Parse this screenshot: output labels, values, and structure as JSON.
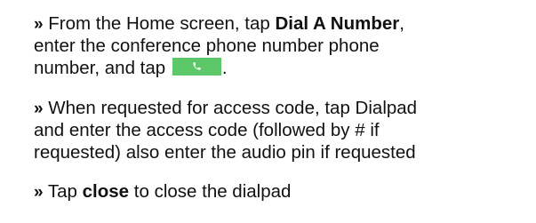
{
  "step1": {
    "bullet": "»",
    "line1_pre": "From the Home screen, tap ",
    "line1_bold": "Dial A Number",
    "line1_post": ",",
    "line2": "enter the conference phone number phone",
    "line3_pre": "number, and tap ",
    "line3_post": ".",
    "button_icon": "phone-icon",
    "button_color": "#5dc86a"
  },
  "step2": {
    "bullet": "»",
    "line1": "When requested for access code, tap Dialpad",
    "line2": "and enter the access code (followed by # if",
    "line3": "requested) also enter the audio pin if requested"
  },
  "step3": {
    "bullet": "»",
    "pre": "Tap ",
    "bold": "close",
    "post": " to close the dialpad"
  }
}
